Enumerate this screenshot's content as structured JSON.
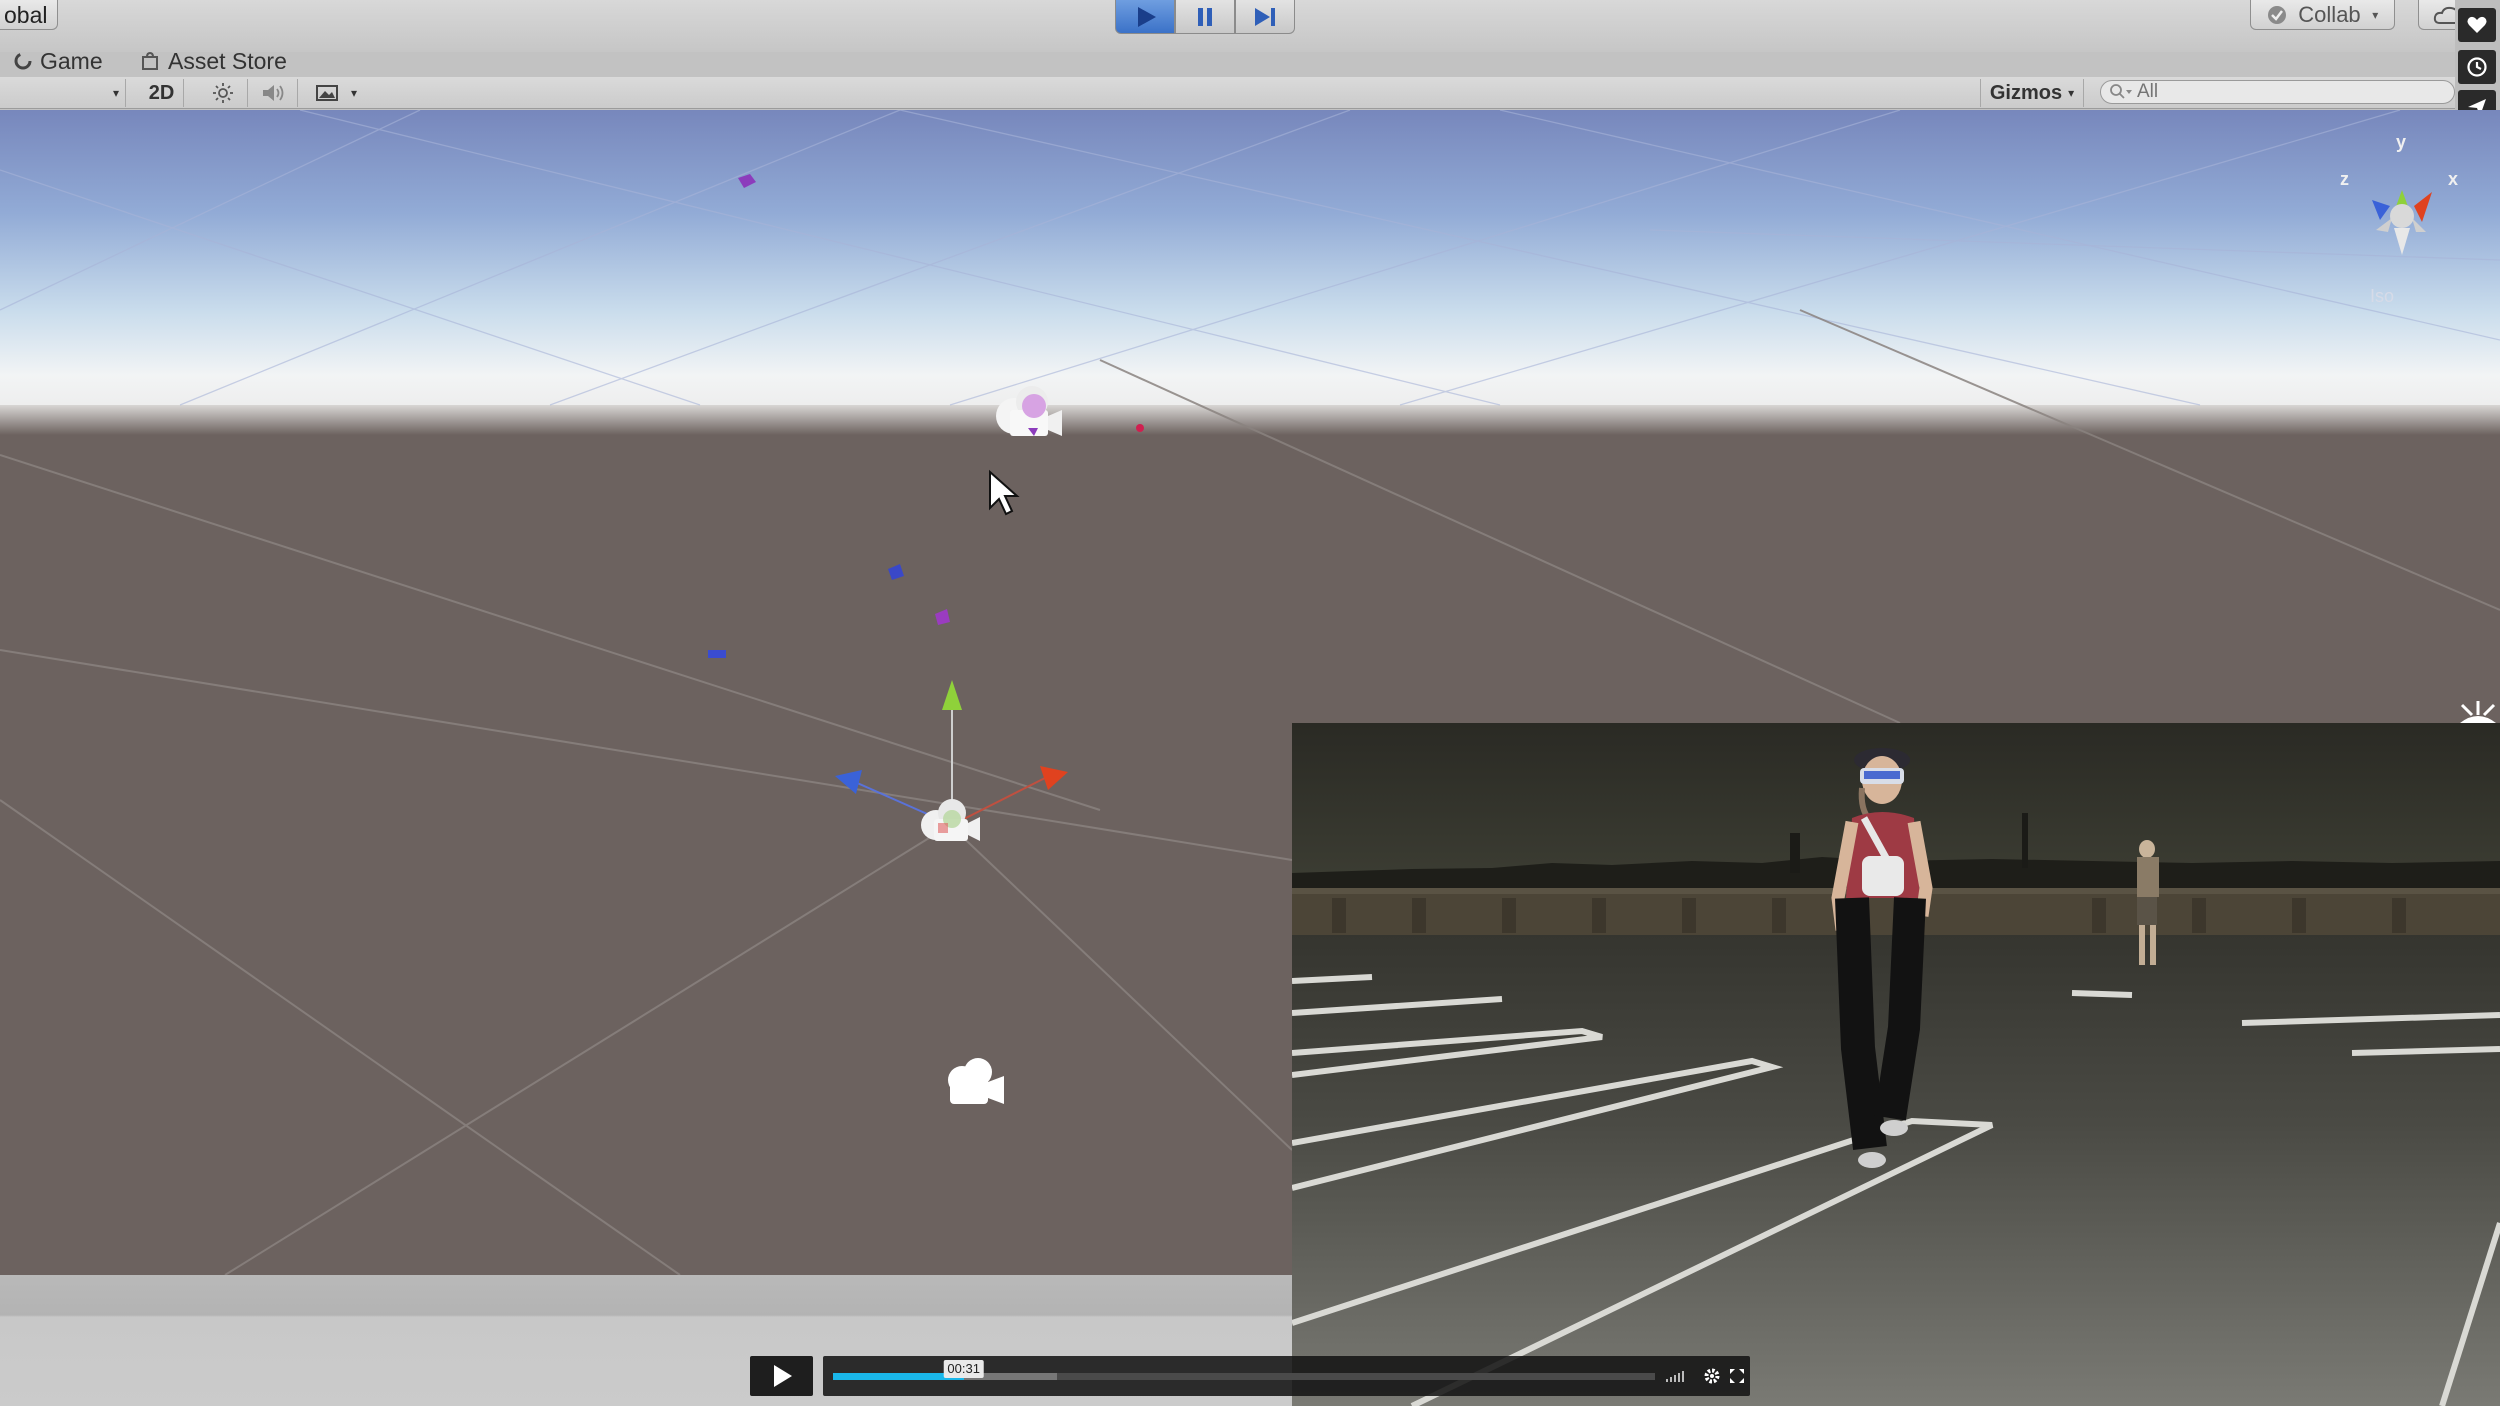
{
  "toolbar": {
    "global_label": "obal",
    "collab_label": "Collab",
    "play_state": "playing"
  },
  "tabs": [
    {
      "label": "Game"
    },
    {
      "label": "Asset Store"
    }
  ],
  "scene_controls": {
    "mode_2d_label": "2D",
    "gizmos_label": "Gizmos",
    "search_placeholder": "All"
  },
  "gizmo": {
    "y_label": "y",
    "x_label": "x",
    "z_label": "z",
    "projection_label": "Iso"
  },
  "player": {
    "time_label": "00:31",
    "progress_fraction": 0.159,
    "buffered_fraction": 0.273
  },
  "colors": {
    "play_blue": "#3b72c8",
    "progress_blue": "#1ab7ea",
    "sky_top": "#7d8fc3",
    "horizon": "#f2f4f5",
    "ground": "#6c625f",
    "axis_y": "#8fd13a",
    "axis_x": "#e0421f",
    "axis_z": "#3a62d8"
  },
  "icons": {
    "play": "play-icon",
    "pause": "pause-icon",
    "step": "step-icon",
    "cloud": "cloud-icon",
    "heart": "heart-icon",
    "history": "history-icon",
    "send": "send-icon"
  }
}
